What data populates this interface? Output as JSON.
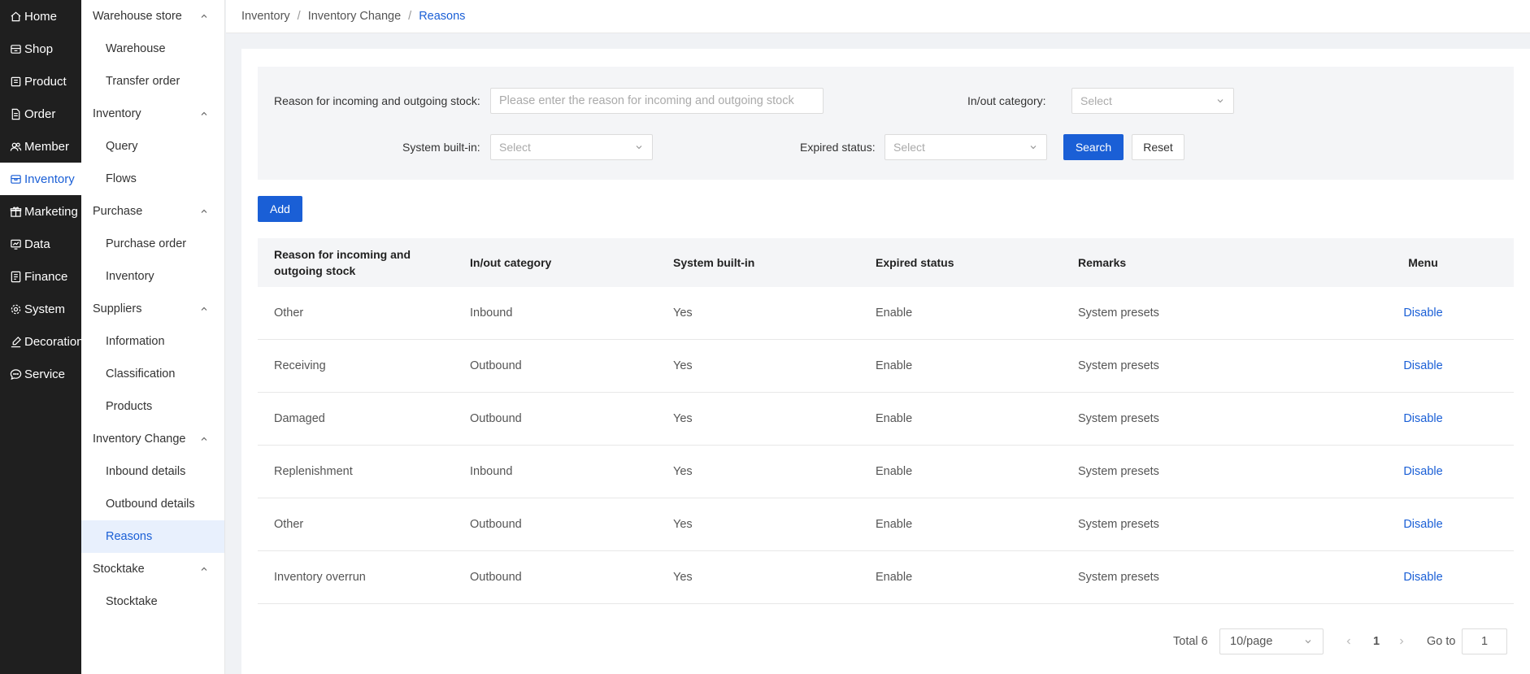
{
  "nav": {
    "items": [
      {
        "label": "Home",
        "icon": "home-icon"
      },
      {
        "label": "Shop",
        "icon": "shop-icon"
      },
      {
        "label": "Product",
        "icon": "product-icon"
      },
      {
        "label": "Order",
        "icon": "order-icon"
      },
      {
        "label": "Member",
        "icon": "member-icon"
      },
      {
        "label": "Inventory",
        "icon": "inventory-icon"
      },
      {
        "label": "Marketing",
        "icon": "marketing-icon"
      },
      {
        "label": "Data",
        "icon": "data-icon"
      },
      {
        "label": "Finance",
        "icon": "finance-icon"
      },
      {
        "label": "System",
        "icon": "system-icon"
      },
      {
        "label": "Decoration",
        "icon": "decoration-icon"
      },
      {
        "label": "Service",
        "icon": "service-icon"
      }
    ],
    "active": "Inventory"
  },
  "subnav": {
    "groups": [
      {
        "label": "Warehouse store",
        "items": [
          "Warehouse",
          "Transfer order"
        ]
      },
      {
        "label": "Inventory",
        "items": [
          "Query",
          "Flows"
        ]
      },
      {
        "label": "Purchase",
        "items": [
          "Purchase order",
          "Inventory"
        ]
      },
      {
        "label": "Suppliers",
        "items": [
          "Information",
          "Classification",
          "Products"
        ]
      },
      {
        "label": "Inventory Change",
        "items": [
          "Inbound details",
          "Outbound details",
          "Reasons"
        ]
      },
      {
        "label": "Stocktake",
        "items": [
          "Stocktake"
        ]
      }
    ],
    "active": "Reasons"
  },
  "breadcrumb": {
    "items": [
      "Inventory",
      "Inventory Change",
      "Reasons"
    ],
    "separator": "/"
  },
  "filter": {
    "reason_label": "Reason for incoming and outgoing stock:",
    "reason_placeholder": "Please enter the reason for incoming and outgoing stock",
    "category_label": "In/out category:",
    "category_placeholder": "Select",
    "builtin_label": "System built-in:",
    "builtin_placeholder": "Select",
    "expired_label": "Expired status:",
    "expired_placeholder": "Select",
    "search_label": "Search",
    "reset_label": "Reset"
  },
  "add_label": "Add",
  "table": {
    "headers": [
      "Reason for incoming and outgoing stock",
      "In/out category",
      "System built-in",
      "Expired status",
      "Remarks",
      "Menu"
    ],
    "rows": [
      {
        "reason": "Other",
        "category": "Inbound",
        "builtin": "Yes",
        "status": "Enable",
        "remarks": "System presets",
        "action": "Disable"
      },
      {
        "reason": "Receiving",
        "category": "Outbound",
        "builtin": "Yes",
        "status": "Enable",
        "remarks": "System presets",
        "action": "Disable"
      },
      {
        "reason": "Damaged",
        "category": "Outbound",
        "builtin": "Yes",
        "status": "Enable",
        "remarks": "System presets",
        "action": "Disable"
      },
      {
        "reason": "Replenishment",
        "category": "Inbound",
        "builtin": "Yes",
        "status": "Enable",
        "remarks": "System presets",
        "action": "Disable"
      },
      {
        "reason": "Other",
        "category": "Outbound",
        "builtin": "Yes",
        "status": "Enable",
        "remarks": "System presets",
        "action": "Disable"
      },
      {
        "reason": "Inventory overrun",
        "category": "Outbound",
        "builtin": "Yes",
        "status": "Enable",
        "remarks": "System presets",
        "action": "Disable"
      }
    ]
  },
  "pagination": {
    "total": "Total 6",
    "page_size": "10/page",
    "current_page": "1",
    "goto_label": "Go to",
    "goto_value": "1"
  },
  "colors": {
    "accent": "#1a5fd6",
    "nav_bg": "#1f1f1f"
  }
}
